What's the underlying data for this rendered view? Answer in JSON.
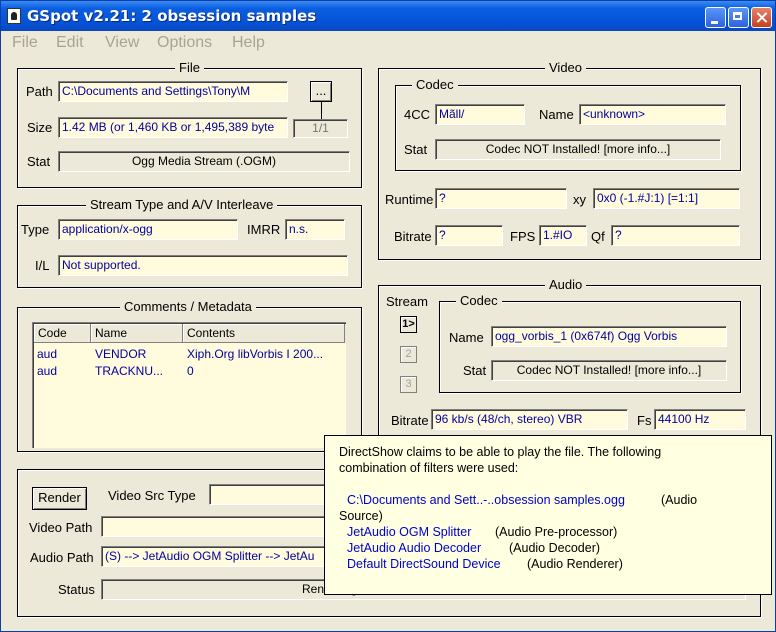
{
  "window": {
    "title": "GSpot v2.21: 2 obsession samples"
  },
  "menu": [
    "File",
    "Edit",
    "View",
    "Options",
    "Help"
  ],
  "file": {
    "group_label": "File",
    "path_label": "Path",
    "path_value": "C:\\Documents and Settings\\Tony\\M",
    "browse_label": "...",
    "size_label": "Size",
    "size_value": "1.42 MB (or 1,460 KB or 1,495,389 byte",
    "part_value": "1/1",
    "stat_label": "Stat",
    "stat_value": "Ogg Media Stream (.OGM)"
  },
  "stream": {
    "group_label": "Stream Type and A/V Interleave",
    "type_label": "Type",
    "type_value": "application/x-ogg",
    "imrr_label": "IMRR",
    "imrr_value": "n.s.",
    "il_label": "I/L",
    "il_value": "Not supported."
  },
  "comments": {
    "group_label": "Comments / Metadata",
    "columns": [
      "Code",
      "Name",
      "Contents"
    ],
    "rows": [
      {
        "code": "aud",
        "name": "VENDOR",
        "contents": "Xiph.Org libVorbis I 200..."
      },
      {
        "code": "aud",
        "name": "TRACKNU...",
        "contents": "0"
      }
    ]
  },
  "video": {
    "group_label": "Video",
    "codec_label": "Codec",
    "fourcc_label": "4CC",
    "fourcc_value": "Mãll/",
    "name_label": "Name",
    "name_value": "<unknown>",
    "stat_label": "Stat",
    "stat_value": "Codec NOT Installed!  [more info...]",
    "runtime_label": "Runtime",
    "runtime_value": "?",
    "xy_label": "xy",
    "xy_value": "0x0 (-1.#J:1) [=1:1]",
    "bitrate_label": "Bitrate",
    "bitrate_value": "?",
    "fps_label": "FPS",
    "fps_value": "1.#IO",
    "qf_label": "Qf",
    "qf_value": "?"
  },
  "audio": {
    "group_label": "Audio",
    "stream_label": "Stream",
    "stream_buttons": [
      "1>",
      "2",
      "3"
    ],
    "codec_label": "Codec",
    "name_label": "Name",
    "name_value": "ogg_vorbis_1 (0x674f) Ogg Vorbis",
    "stat_label": "Stat",
    "stat_value": "Codec NOT Installed!  [more info...]",
    "bitrate_label": "Bitrate",
    "bitrate_value": "96 kb/s (48/ch, stereo) VBR",
    "fs_label": "Fs",
    "fs_value": "44100 Hz"
  },
  "render": {
    "button_label": "Render",
    "video_src_label": "Video Src Type",
    "video_src_value": "",
    "video_path_label": "Video Path",
    "video_path_value": "",
    "audio_path_label": "Audio Path",
    "audio_path_value": "(S) --> JetAudio OGM Splitter --> JetAu",
    "status_label": "Status",
    "status_value": "Rendering"
  },
  "tooltip": {
    "intro_1": "DirectShow claims to be able to play the file.  The following",
    "intro_2": "combination of filters were used:",
    "filter_1_name": "C:\\Documents and Sett..-..obsession samples.ogg",
    "filter_1_role_a": "(Audio",
    "filter_1_role_b": "Source)",
    "filter_2_name": "JetAudio OGM Splitter",
    "filter_2_role": "(Audio Pre-processor)",
    "filter_3_name": "JetAudio Audio Decoder",
    "filter_3_role": "(Audio Decoder)",
    "filter_4_name": "Default DirectSound Device",
    "filter_4_role": "(Audio Renderer)"
  }
}
